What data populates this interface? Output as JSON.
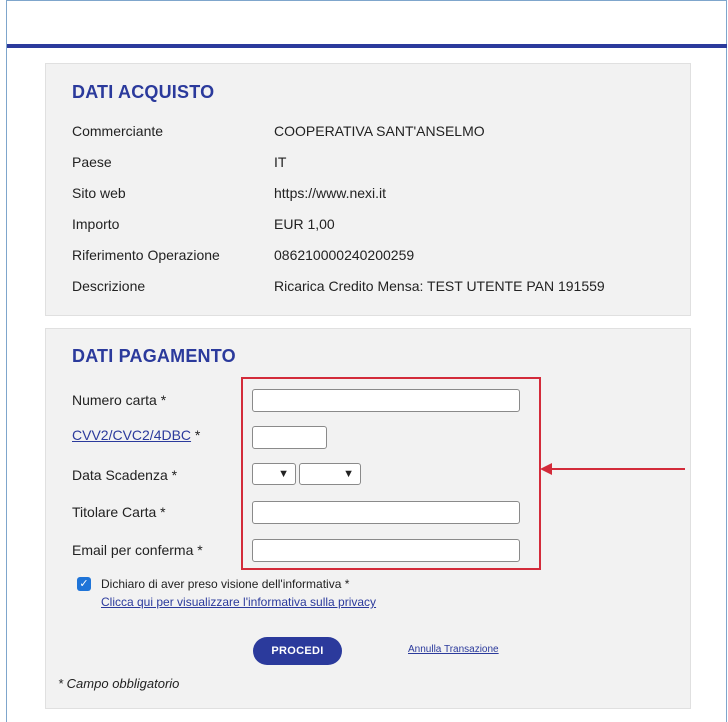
{
  "purchase": {
    "title": "DATI ACQUISTO",
    "rows": [
      {
        "label": "Commerciante",
        "value": "COOPERATIVA SANT'ANSELMO"
      },
      {
        "label": "Paese",
        "value": "IT"
      },
      {
        "label": "Sito web",
        "value": "https://www.nexi.it"
      },
      {
        "label": "Importo",
        "value": "EUR 1,00"
      },
      {
        "label": "Riferimento Operazione",
        "value": "086210000240200259"
      },
      {
        "label": "Descrizione",
        "value": "Ricarica Credito Mensa: TEST UTENTE PAN 191559"
      }
    ]
  },
  "payment": {
    "title": "DATI PAGAMENTO",
    "card_number_label": "Numero carta *",
    "card_number_value": "",
    "cvv_link_text": "CVV2/CVC2/4DBC",
    "cvv_required_mark": " *",
    "cvv_value": "",
    "expiry_label": "Data Scadenza *",
    "expiry_month_value": "",
    "expiry_year_value": "",
    "holder_label": "Titolare Carta *",
    "holder_value": "",
    "email_label": "Email per conferma *",
    "email_value": "",
    "consent_checked": true,
    "consent_text": "Dichiaro di aver preso visione dell'informativa *",
    "privacy_link_text": "Clicca qui per visualizzare l'informativa sulla privacy",
    "proceed_label": "PROCEDI",
    "cancel_label": "Annulla Transazione",
    "required_note": "* Campo obbligatorio"
  },
  "colors": {
    "brand": "#2b3a9c",
    "annotation": "#d32b3a",
    "checkbox": "#1f74d8"
  },
  "icons": {
    "select_chevron": "chevron-down-icon",
    "checkbox": "checkmark-icon",
    "annotation_arrow": "arrow-left-icon"
  }
}
